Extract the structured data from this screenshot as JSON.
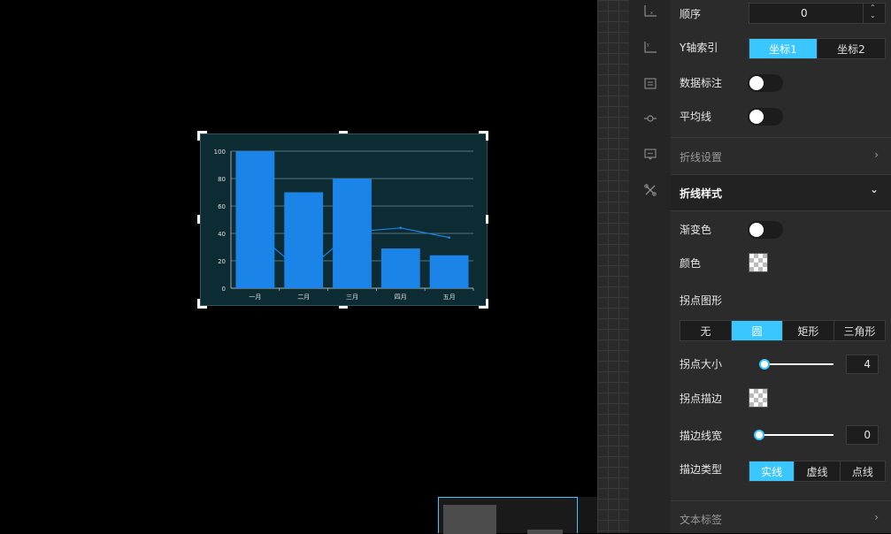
{
  "chart_data": {
    "type": "bar",
    "categories": [
      "一月",
      "二月",
      "三月",
      "四月",
      "五月"
    ],
    "series": [
      {
        "type": "bar",
        "values": [
          100,
          70,
          80,
          29,
          24
        ]
      },
      {
        "type": "line",
        "values": [
          41,
          11,
          41,
          44,
          37
        ]
      }
    ],
    "yticks": [
      "100",
      "80",
      "60",
      "40",
      "20",
      "0"
    ],
    "ylim": [
      0,
      100
    ],
    "grid": true,
    "colors": {
      "bar": "#1a84e8",
      "line": "#1a84e8",
      "background": "#0c2b33"
    }
  },
  "panel": {
    "order": {
      "label": "顺序",
      "value": "0",
      "up": "⌃",
      "down": "⌄"
    },
    "y_axis_index": {
      "label": "Y轴索引",
      "options": [
        "坐标1",
        "坐标2"
      ],
      "selected": 0
    },
    "data_label": {
      "label": "数据标注",
      "on": false
    },
    "avg_line": {
      "label": "平均线",
      "on": false
    },
    "line_settings": {
      "label": "折线设置",
      "chevron": "›"
    },
    "line_style": {
      "label": "折线样式",
      "chevron": "⌄"
    },
    "gradient": {
      "label": "渐变色",
      "on": false
    },
    "color": {
      "label": "颜色"
    },
    "point_shape": {
      "label": "拐点图形",
      "options": [
        "无",
        "圆",
        "矩形",
        "三角形"
      ],
      "selected": 1
    },
    "point_size": {
      "label": "拐点大小",
      "value": "4"
    },
    "point_stroke": {
      "label": "拐点描边"
    },
    "stroke_width": {
      "label": "描边线宽",
      "value": "0"
    },
    "stroke_type": {
      "label": "描边类型",
      "options": [
        "实线",
        "虚线",
        "点线"
      ],
      "selected": 0
    },
    "text_label": {
      "label": "文本标签",
      "chevron": "›"
    }
  },
  "rail_icons": [
    "x-axis-icon",
    "y-axis-icon",
    "data-series-icon",
    "line-node-icon",
    "tooltip-icon",
    "tools-icon"
  ],
  "accent": "#3ac6ff"
}
